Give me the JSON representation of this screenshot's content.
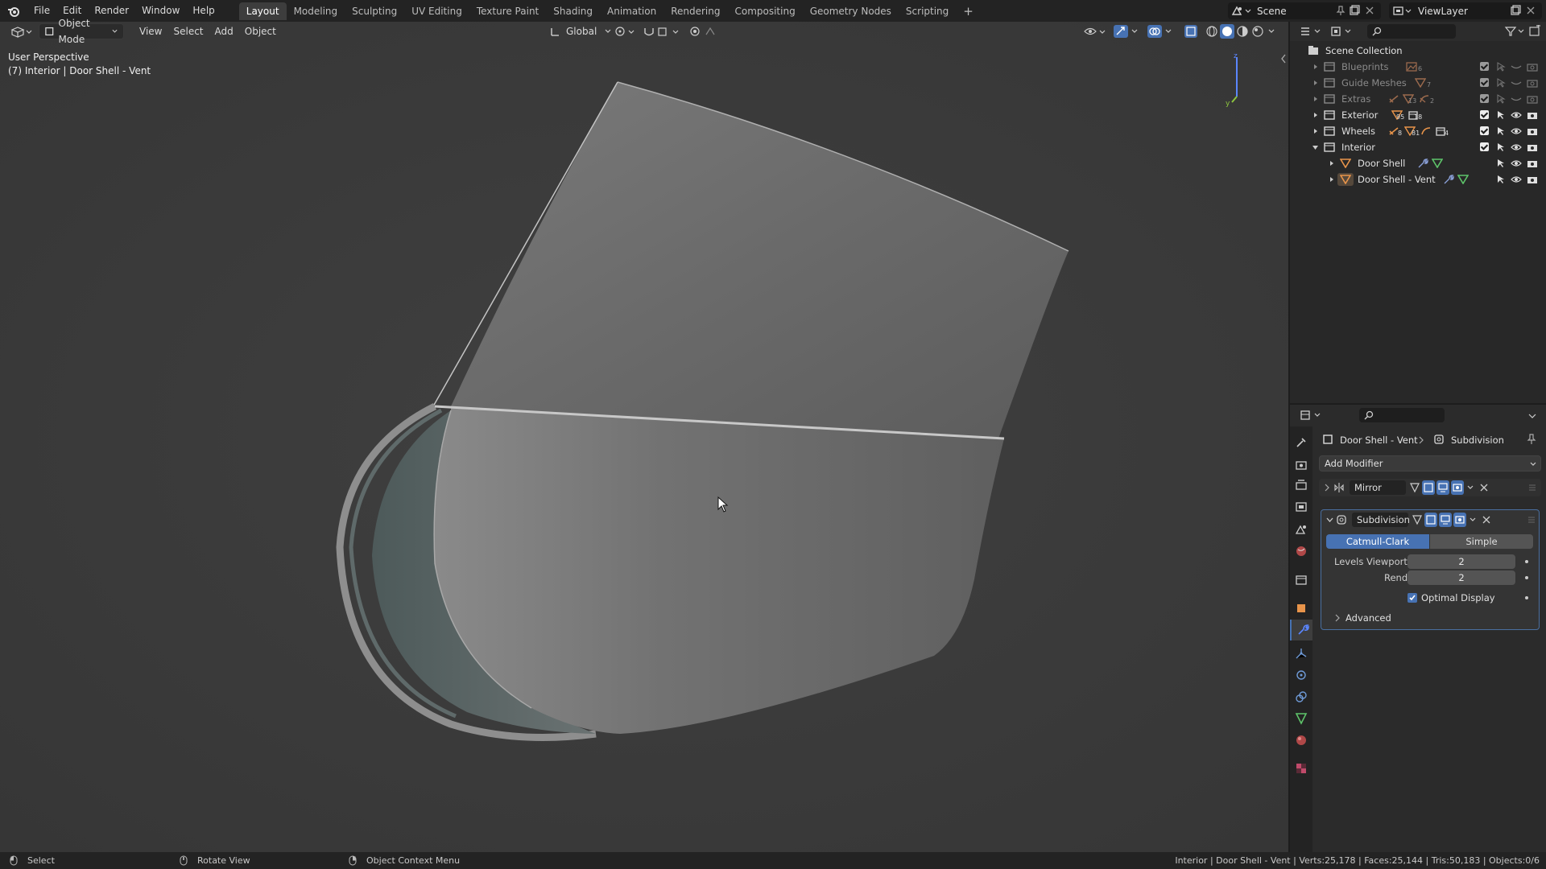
{
  "menu": {
    "file": "File",
    "edit": "Edit",
    "render": "Render",
    "window": "Window",
    "help": "Help"
  },
  "workspaces": [
    "Layout",
    "Modeling",
    "Sculpting",
    "UV Editing",
    "Texture Paint",
    "Shading",
    "Animation",
    "Rendering",
    "Compositing",
    "Geometry Nodes",
    "Scripting"
  ],
  "add_workspace": "+",
  "scene": "Scene",
  "view_layer": "ViewLayer",
  "viewport": {
    "mode": "Object Mode",
    "view": "View",
    "select": "Select",
    "add": "Add",
    "object": "Object",
    "orientation": "Global",
    "perspective": "User Perspective",
    "active_info": "(7) Interior | Door Shell - Vent"
  },
  "outliner": {
    "root": "Scene Collection",
    "items": [
      {
        "name": "Blueprints",
        "count": "6",
        "dim": true
      },
      {
        "name": "Guide Meshes",
        "count": "7",
        "dim": true
      },
      {
        "name": "Extras",
        "count": "13",
        "count2": "2",
        "dim": true
      },
      {
        "name": "Exterior",
        "count": "95",
        "count2": "18",
        "dim": false
      },
      {
        "name": "Wheels",
        "count": "8",
        "count2": "81",
        "count3": "4",
        "dim": false
      },
      {
        "name": "Interior",
        "dim": false
      },
      {
        "name": "Door Shell",
        "dim": false
      },
      {
        "name": "Door Shell - Vent",
        "dim": false
      }
    ]
  },
  "properties": {
    "breadcrumb_object": "Door Shell - Vent",
    "breadcrumb_modifier": "Subdivision",
    "add_modifier": "Add Modifier",
    "mirror": "Mirror",
    "subdivision": "Subdivision",
    "catmull_clark": "Catmull-Clark",
    "simple": "Simple",
    "levels_viewport_label": "Levels Viewport",
    "levels_viewport_value": "2",
    "render_label": "Render",
    "render_value": "2",
    "optimal_display": "Optimal Display",
    "advanced": "Advanced"
  },
  "status": {
    "select": "Select",
    "rotate": "Rotate View",
    "context": "Object Context Menu",
    "stats": "Interior | Door Shell - Vent | Verts:25,178 | Faces:25,144 | Tris:50,183 | Objects:0/6"
  },
  "colors": {
    "accent": "#4772b3",
    "viewport_bg": "#3b3b3b",
    "axis_z": "#5b86ff",
    "axis_y": "#8ec63f"
  }
}
